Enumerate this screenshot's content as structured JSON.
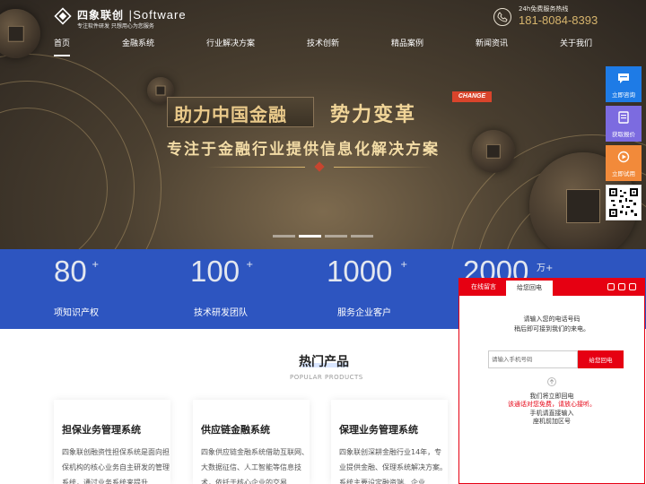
{
  "header": {
    "logo_cn": "四象联创",
    "logo_sep": "|",
    "logo_en": "Software",
    "logo_sub": "专注软件研发 只想用心为您服务",
    "hotline_label": "24h免费服务热线",
    "hotline_number": "181-8084-8393"
  },
  "nav": [
    {
      "label": "首页",
      "active": true
    },
    {
      "label": "金融系统"
    },
    {
      "label": "行业解决方案"
    },
    {
      "label": "技术创新"
    },
    {
      "label": "精品案例"
    },
    {
      "label": "新闻资讯"
    },
    {
      "label": "关于我们"
    }
  ],
  "hero": {
    "line1": "助力中国金融",
    "line2": "势力变革",
    "badge": "CHANGE",
    "line3": "专注于金融行业提供信息化解决方案",
    "slides": 4,
    "active_slide": 2
  },
  "stats": [
    {
      "value": "80",
      "sup": "+",
      "label": "项知识产权"
    },
    {
      "value": "100",
      "sup": "+",
      "label": "技术研发团队"
    },
    {
      "value": "1000",
      "sup": "+",
      "label": "服务企业客户"
    },
    {
      "value": "2000",
      "sup": "万+",
      "label": ""
    }
  ],
  "products": {
    "title": "热门产品",
    "subtitle": "POPULAR PRODUCTS",
    "cards": [
      {
        "title": "担保业务管理系统",
        "desc": "四象联创融资性担保系统是面向担保机构的核心业务自主研发的管理系统，通过业务系统来提升"
      },
      {
        "title": "供应链金融系统",
        "desc": "四象供应链金融系统借助互联网、大数据征信、人工智能等信息技术，依托于核心企业的交易"
      },
      {
        "title": "保理业务管理系统",
        "desc": "四象联创深耕金融行业14年，专业提供金融、保理系统解决方案。系统主要设定融资端、企业"
      }
    ]
  },
  "sidebar": {
    "consult": "立即咨询",
    "quote": "获取报价",
    "trial": "立即试用",
    "colors": {
      "consult": "#1e7be6",
      "quote": "#7c6be0",
      "trial": "#f28a3a"
    }
  },
  "widget": {
    "tab_message": "在线留言",
    "tab_callback": "给您回电",
    "hint1": "请输入您的电话号码",
    "hint2": "稍后即可接到我们的来电。",
    "placeholder": "请输入手机号码",
    "submit": "给您回电",
    "note1": "我们将立即回电",
    "note2": "该通话对您免费，请放心接听。",
    "note3": "手机请直接输入",
    "note4": "座机前加区号"
  }
}
